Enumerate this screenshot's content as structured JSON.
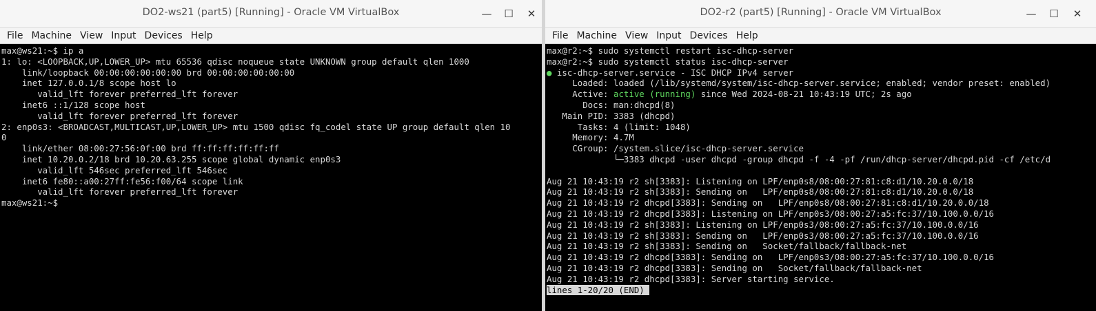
{
  "left_window": {
    "title": "DO2-ws21 (part5) [Running] - Oracle VM VirtualBox",
    "menu": [
      "File",
      "Machine",
      "View",
      "Input",
      "Devices",
      "Help"
    ],
    "controls": {
      "minimize": "—",
      "maximize": "☐",
      "close": "✕"
    },
    "terminal_lines": [
      "max@ws21:~$ ip a",
      "1: lo: <LOOPBACK,UP,LOWER_UP> mtu 65536 qdisc noqueue state UNKNOWN group default qlen 1000",
      "    link/loopback 00:00:00:00:00:00 brd 00:00:00:00:00:00",
      "    inet 127.0.0.1/8 scope host lo",
      "       valid_lft forever preferred_lft forever",
      "    inet6 ::1/128 scope host",
      "       valid_lft forever preferred_lft forever",
      "2: enp0s3: <BROADCAST,MULTICAST,UP,LOWER_UP> mtu 1500 qdisc fq_codel state UP group default qlen 10",
      "0",
      "    link/ether 08:00:27:56:0f:00 brd ff:ff:ff:ff:ff:ff",
      "    inet 10.20.0.2/18 brd 10.20.63.255 scope global dynamic enp0s3",
      "       valid_lft 546sec preferred_lft 546sec",
      "    inet6 fe80::a00:27ff:fe56:f00/64 scope link",
      "       valid_lft forever preferred_lft forever",
      "max@ws21:~$"
    ]
  },
  "right_window": {
    "title": "DO2-r2 (part5) [Running] - Oracle VM VirtualBox",
    "menu": [
      "File",
      "Machine",
      "View",
      "Input",
      "Devices",
      "Help"
    ],
    "controls": {
      "minimize": "—",
      "maximize": "☐",
      "close": "✕"
    },
    "terminal": {
      "cmd1": "max@r2:~$ sudo systemctl restart isc-dhcp-server",
      "cmd2": "max@r2:~$ sudo systemctl status isc-dhcp-server",
      "bullet": "●",
      "service_line": " isc-dhcp-server.service - ISC DHCP IPv4 server",
      "loaded": "     Loaded: loaded (/lib/systemd/system/isc-dhcp-server.service; enabled; vendor preset: enabled)",
      "active_prefix": "     Active: ",
      "active_state": "active (running)",
      "active_suffix": " since Wed 2024-08-21 10:43:19 UTC; 2s ago",
      "docs": "       Docs: man:dhcpd(8)",
      "main_pid": "   Main PID: 3383 (dhcpd)",
      "tasks": "      Tasks: 4 (limit: 1048)",
      "memory": "     Memory: 4.7M",
      "cgroup": "     CGroup: /system.slice/isc-dhcp-server.service",
      "cgroup_proc": "             └─3383 dhcpd -user dhcpd -group dhcpd -f -4 -pf /run/dhcp-server/dhcpd.pid -cf /etc/d",
      "blank": "",
      "logs": [
        "Aug 21 10:43:19 r2 sh[3383]: Listening on LPF/enp0s8/08:00:27:81:c8:d1/10.20.0.0/18",
        "Aug 21 10:43:19 r2 sh[3383]: Sending on   LPF/enp0s8/08:00:27:81:c8:d1/10.20.0.0/18",
        "Aug 21 10:43:19 r2 dhcpd[3383]: Sending on   LPF/enp0s8/08:00:27:81:c8:d1/10.20.0.0/18",
        "Aug 21 10:43:19 r2 dhcpd[3383]: Listening on LPF/enp0s3/08:00:27:a5:fc:37/10.100.0.0/16",
        "Aug 21 10:43:19 r2 sh[3383]: Listening on LPF/enp0s3/08:00:27:a5:fc:37/10.100.0.0/16",
        "Aug 21 10:43:19 r2 sh[3383]: Sending on   LPF/enp0s3/08:00:27:a5:fc:37/10.100.0.0/16",
        "Aug 21 10:43:19 r2 sh[3383]: Sending on   Socket/fallback/fallback-net",
        "Aug 21 10:43:19 r2 dhcpd[3383]: Sending on   LPF/enp0s3/08:00:27:a5:fc:37/10.100.0.0/16",
        "Aug 21 10:43:19 r2 dhcpd[3383]: Sending on   Socket/fallback/fallback-net",
        "Aug 21 10:43:19 r2 dhcpd[3383]: Server starting service."
      ],
      "pager": "lines 1-20/20 (END)"
    }
  },
  "colors": {
    "terminal_bg": "#000000",
    "terminal_fg": "#d8d8d8",
    "active_green": "#5fd75f",
    "titlebar_bg": "#f6f6f6",
    "menubar_bg": "#f4f4f4"
  }
}
